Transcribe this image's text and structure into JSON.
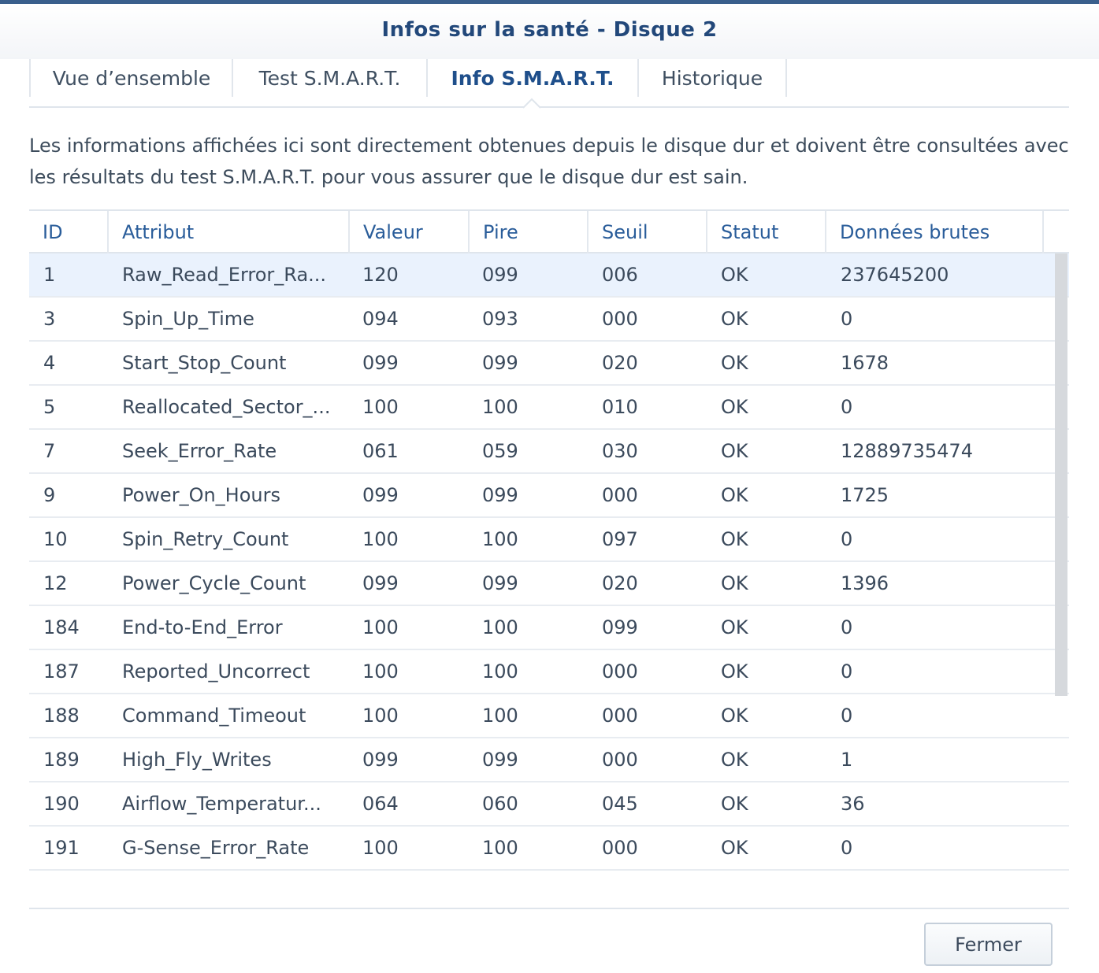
{
  "window": {
    "title": "Infos sur la santé - Disque 2"
  },
  "tabs": [
    {
      "label": "Vue d’ensemble",
      "active": false
    },
    {
      "label": "Test S.M.A.R.T.",
      "active": false
    },
    {
      "label": "Info S.M.A.R.T.",
      "active": true
    },
    {
      "label": "Historique",
      "active": false
    }
  ],
  "description": "Les informations affichées ici sont directement obtenues depuis le disque dur et doivent être consultées avec les résultats du test S.M.A.R.T. pour vous assurer que le disque dur est sain.",
  "table": {
    "columns": [
      "ID",
      "Attribut",
      "Valeur",
      "Pire",
      "Seuil",
      "Statut",
      "Données brutes"
    ],
    "rows": [
      [
        "1",
        "Raw_Read_Error_Ra...",
        "120",
        "099",
        "006",
        "OK",
        "237645200"
      ],
      [
        "3",
        "Spin_Up_Time",
        "094",
        "093",
        "000",
        "OK",
        "0"
      ],
      [
        "4",
        "Start_Stop_Count",
        "099",
        "099",
        "020",
        "OK",
        "1678"
      ],
      [
        "5",
        "Reallocated_Sector_...",
        "100",
        "100",
        "010",
        "OK",
        "0"
      ],
      [
        "7",
        "Seek_Error_Rate",
        "061",
        "059",
        "030",
        "OK",
        "12889735474"
      ],
      [
        "9",
        "Power_On_Hours",
        "099",
        "099",
        "000",
        "OK",
        "1725"
      ],
      [
        "10",
        "Spin_Retry_Count",
        "100",
        "100",
        "097",
        "OK",
        "0"
      ],
      [
        "12",
        "Power_Cycle_Count",
        "099",
        "099",
        "020",
        "OK",
        "1396"
      ],
      [
        "184",
        "End-to-End_Error",
        "100",
        "100",
        "099",
        "OK",
        "0"
      ],
      [
        "187",
        "Reported_Uncorrect",
        "100",
        "100",
        "000",
        "OK",
        "0"
      ],
      [
        "188",
        "Command_Timeout",
        "100",
        "100",
        "000",
        "OK",
        "0"
      ],
      [
        "189",
        "High_Fly_Writes",
        "099",
        "099",
        "000",
        "OK",
        "1"
      ],
      [
        "190",
        "Airflow_Temperatur...",
        "064",
        "060",
        "045",
        "OK",
        "36"
      ],
      [
        "191",
        "G-Sense_Error_Rate",
        "100",
        "100",
        "000",
        "OK",
        "0"
      ]
    ],
    "selected_row": 0
  },
  "footer": {
    "close_label": "Fermer"
  },
  "colors": {
    "title": "#22487a",
    "header_text": "#2a5d9a",
    "selected_row": "#eaf2fd",
    "top_border": "#3a5f8c"
  }
}
